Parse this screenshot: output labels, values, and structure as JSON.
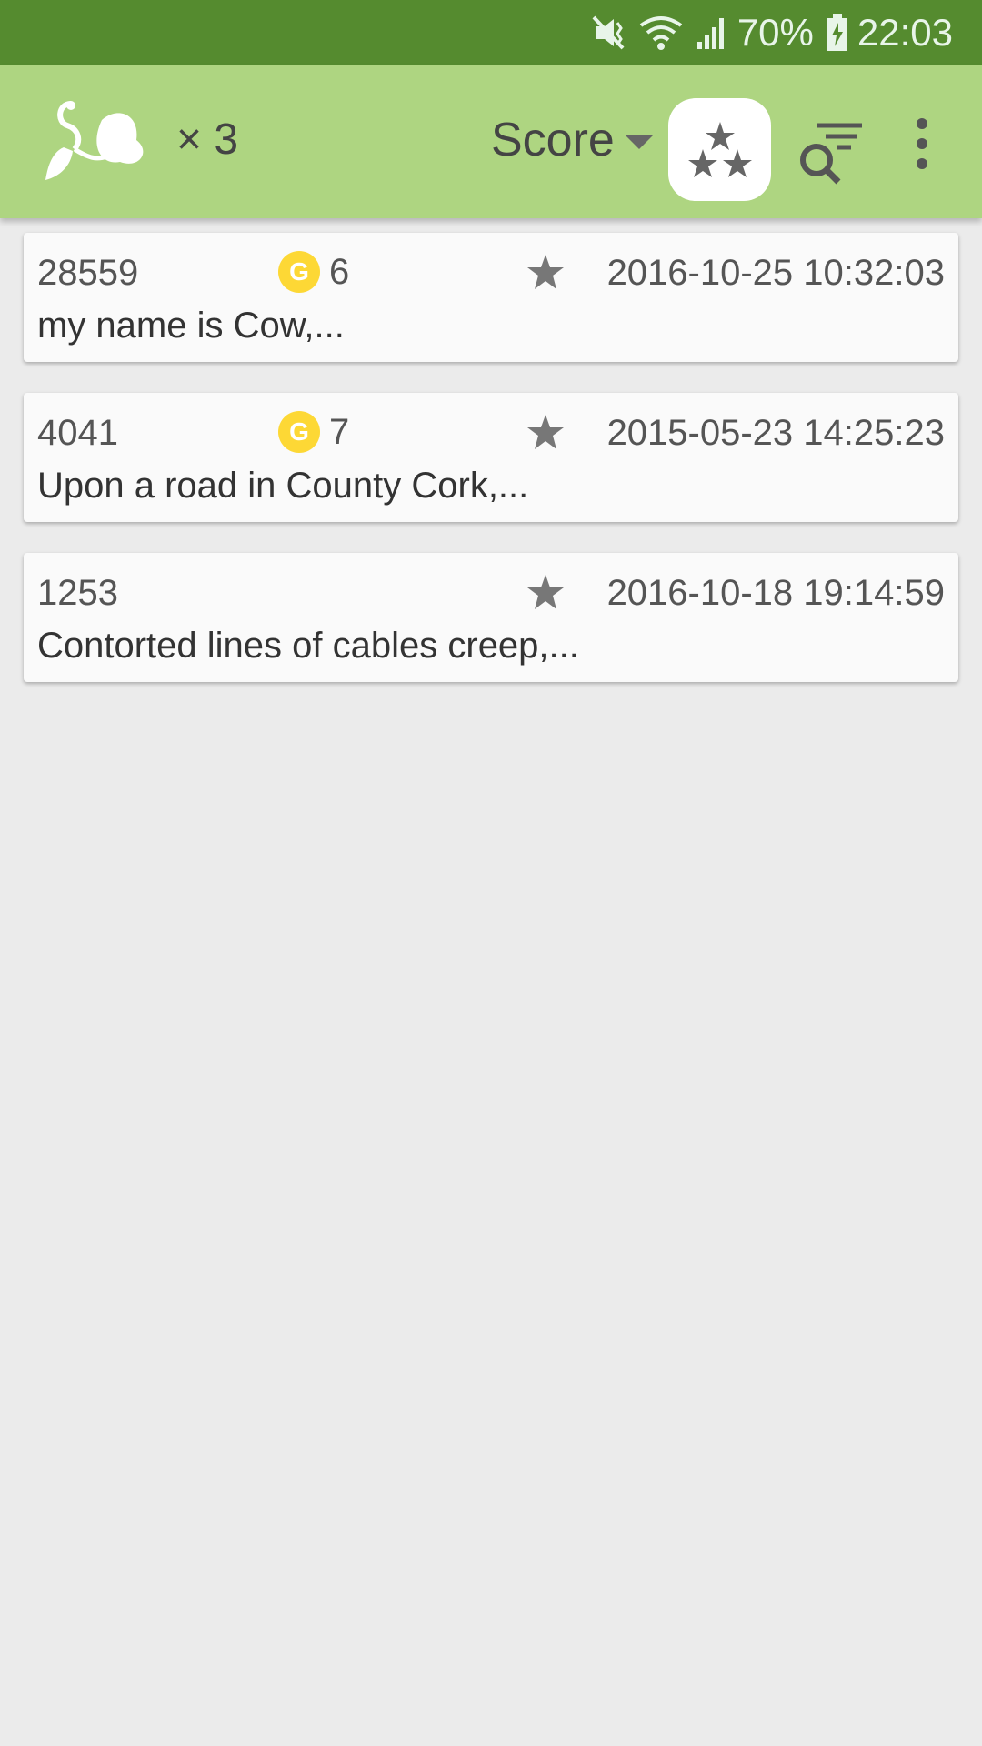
{
  "status_bar": {
    "battery": "70%",
    "time": "22:03",
    "icons": [
      "mute-vibrate-icon",
      "wifi-icon",
      "signal-icon",
      "battery-charging-icon"
    ]
  },
  "app_bar": {
    "count": "× 3",
    "sort_label": "Score",
    "colors": {
      "app_bar": "#aed581",
      "status_bar": "#558b2f",
      "coin": "#fdd835"
    }
  },
  "posts": [
    {
      "id": "28559",
      "gold": "6",
      "date": "2016-10-25 10:32:03",
      "preview": "my name is Cow,..."
    },
    {
      "id": "4041",
      "gold": "7",
      "date": "2015-05-23 14:25:23",
      "preview": "Upon a road in County Cork,..."
    },
    {
      "id": "1253",
      "date": "2016-10-18 19:14:59",
      "preview": "Contorted lines of cables creep,..."
    }
  ]
}
